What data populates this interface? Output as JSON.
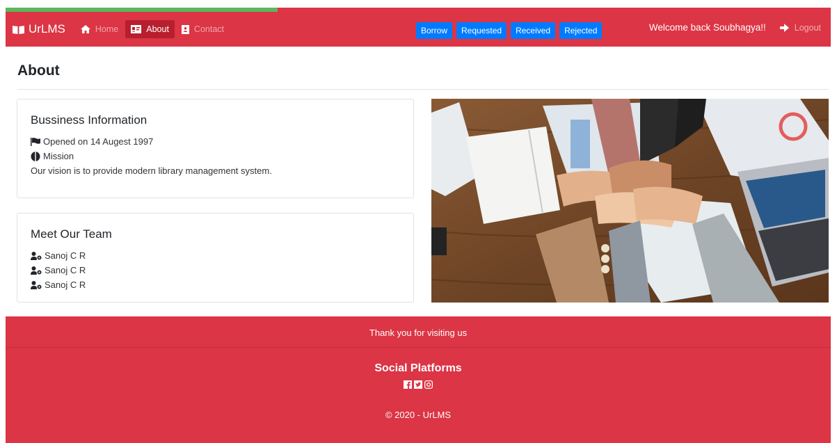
{
  "progress": {
    "fraction": 0.33
  },
  "navbar": {
    "brand": "UrLMS",
    "links": [
      {
        "label": "Home",
        "icon": "home-icon"
      },
      {
        "label": "About",
        "icon": "id-card-icon",
        "active": true
      },
      {
        "label": "Contact",
        "icon": "contact-book-icon"
      }
    ],
    "actions": [
      "Borrow",
      "Requested",
      "Received",
      "Rejected"
    ],
    "welcome": "Welcome back Soubhagya!!",
    "logout": "Logout"
  },
  "page": {
    "title": "About"
  },
  "business": {
    "title": "Bussiness Information",
    "opened": "Opened on 14 Augest 1997",
    "mission_label": "Mission",
    "vision": "Our vision is to provide modern library management system."
  },
  "team": {
    "title": "Meet Our Team",
    "members": [
      "Sanoj C R",
      "Sanoj C R",
      "Sanoj C R"
    ]
  },
  "footer": {
    "thanks": "Thank you for visiting us",
    "social_title": "Social Platforms",
    "social_icons": [
      "facebook-icon",
      "twitter-icon",
      "instagram-icon"
    ],
    "copyright": "© 2020 - UrLMS"
  },
  "colors": {
    "navbar": "#dc3545",
    "progress": "#5cb85c",
    "action_button": "#007bff"
  }
}
